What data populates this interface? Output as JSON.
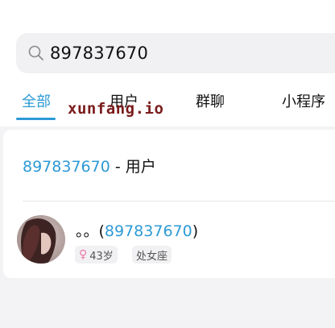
{
  "search": {
    "query": "897837670",
    "icon": "search-icon"
  },
  "tabs": [
    {
      "label": "全部",
      "active": true
    },
    {
      "label": "用户",
      "active": false
    },
    {
      "label": "群聊",
      "active": false
    },
    {
      "label": "小程序",
      "active": false
    }
  ],
  "watermark": "xunfang.io",
  "section": {
    "number": "897837670",
    "suffix": " - 用户"
  },
  "result": {
    "name_prefix": "。。(",
    "number": "897837670",
    "name_suffix": ")",
    "gender_icon": "female-icon",
    "gender_glyph": "♀",
    "age": "43岁",
    "zodiac": "处女座"
  },
  "colors": {
    "accent": "#2d9ad6",
    "female": "#ef7aa8",
    "watermark": "#7a1b1b"
  }
}
